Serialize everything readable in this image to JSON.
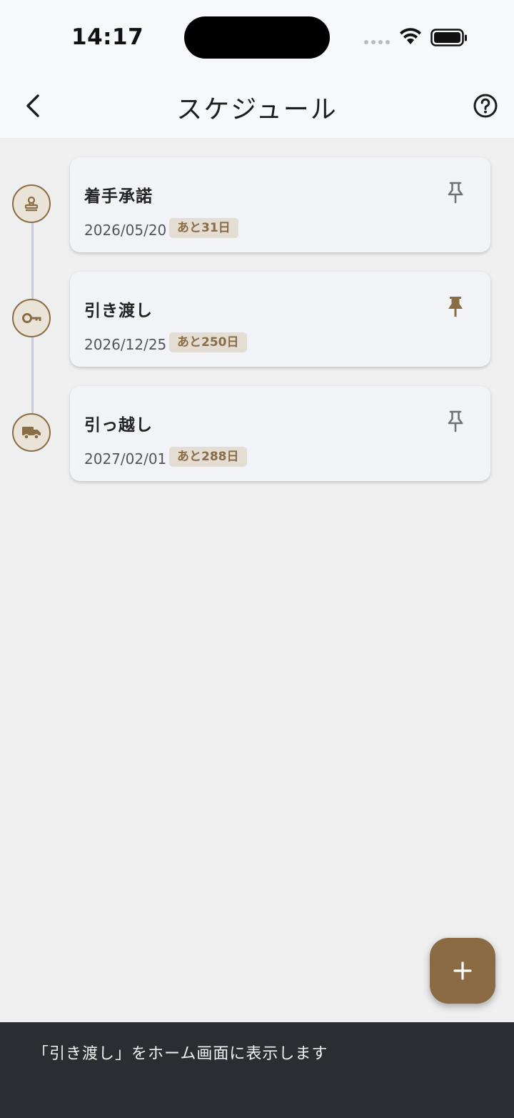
{
  "status_bar": {
    "time": "14:17"
  },
  "nav": {
    "title": "スケジュール",
    "back_icon": "chevron-left-icon",
    "help_icon": "question-circle-icon"
  },
  "schedule": {
    "items": [
      {
        "title": "着手承諾",
        "date": "2026/05/20",
        "remaining": "あと31日",
        "icon": "stamp-icon",
        "pinned": false
      },
      {
        "title": "引き渡し",
        "date": "2026/12/25",
        "remaining": "あと250日",
        "icon": "key-icon",
        "pinned": true
      },
      {
        "title": "引っ越し",
        "date": "2027/02/01",
        "remaining": "あと288日",
        "icon": "truck-icon",
        "pinned": false
      }
    ]
  },
  "fab": {
    "icon": "plus-icon"
  },
  "snackbar": {
    "message": "「引き渡し」をホーム画面に表示します"
  },
  "colors": {
    "accent": "#8b6b44",
    "background": "#efefef",
    "card": "#f2f3f7",
    "pin_inactive": "#6e7178",
    "snackbar": "#2a2d31"
  }
}
